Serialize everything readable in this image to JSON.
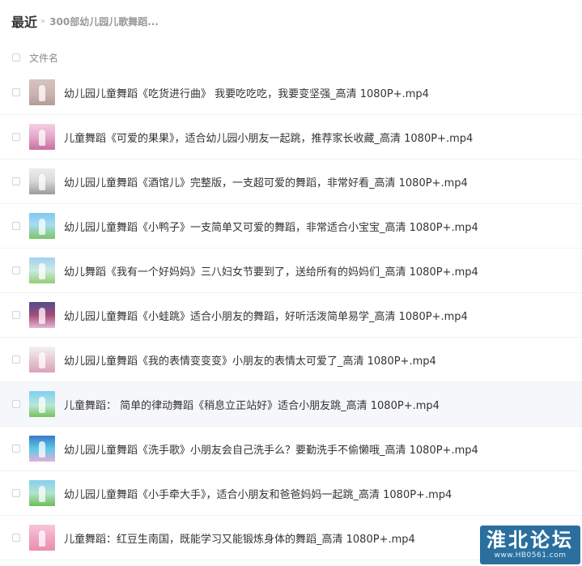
{
  "breadcrumb": {
    "home": "最近",
    "separator": "»",
    "current": "300部幼儿园儿歌舞蹈..."
  },
  "list": {
    "header_label": "文件名",
    "files": [
      {
        "name": "幼儿园儿童舞蹈《吃货进行曲》 我要吃吃吃，我要变坚强_高清 1080P+.mp4"
      },
      {
        "name": "儿童舞蹈《可爱的果果》，适合幼儿园小朋友一起跳，推荐家长收藏_高清 1080P+.mp4"
      },
      {
        "name": "幼儿园儿童舞蹈《酒馆儿》完整版，一支超可爱的舞蹈，非常好看_高清 1080P+.mp4"
      },
      {
        "name": "幼儿园儿童舞蹈《小鸭子》一支简单又可爱的舞蹈，非常适合小宝宝_高清 1080P+.mp4"
      },
      {
        "name": "幼儿舞蹈《我有一个好妈妈》三八妇女节要到了，送给所有的妈妈们_高清 1080P+.mp4"
      },
      {
        "name": "幼儿园儿童舞蹈《小蛙跳》适合小朋友的舞蹈，好听活泼简单易学_高清 1080P+.mp4"
      },
      {
        "name": "幼儿园儿童舞蹈《我的表情变变变》小朋友的表情太可爱了_高清 1080P+.mp4"
      },
      {
        "name": "儿童舞蹈： 简单的律动舞蹈《稍息立正站好》适合小朋友跳_高清 1080P+.mp4"
      },
      {
        "name": "幼儿园儿童舞蹈《洗手歌》小朋友会自己洗手么？要勤洗手不偷懒哦_高清 1080P+.mp4"
      },
      {
        "name": "幼儿园儿童舞蹈《小手牵大手》，适合小朋友和爸爸妈妈一起跳_高清 1080P+.mp4"
      },
      {
        "name": "儿童舞蹈：红豆生南国，既能学习又能锻炼身体的舞蹈_高清 1080P+.mp4"
      }
    ]
  },
  "watermark": {
    "title": "淮北论坛",
    "url": "www.HB0561.com"
  },
  "colors": {
    "hover_row": "#f6f7fb",
    "divider": "#f1f2f4",
    "watermark_bg": "#2a6f9e"
  }
}
